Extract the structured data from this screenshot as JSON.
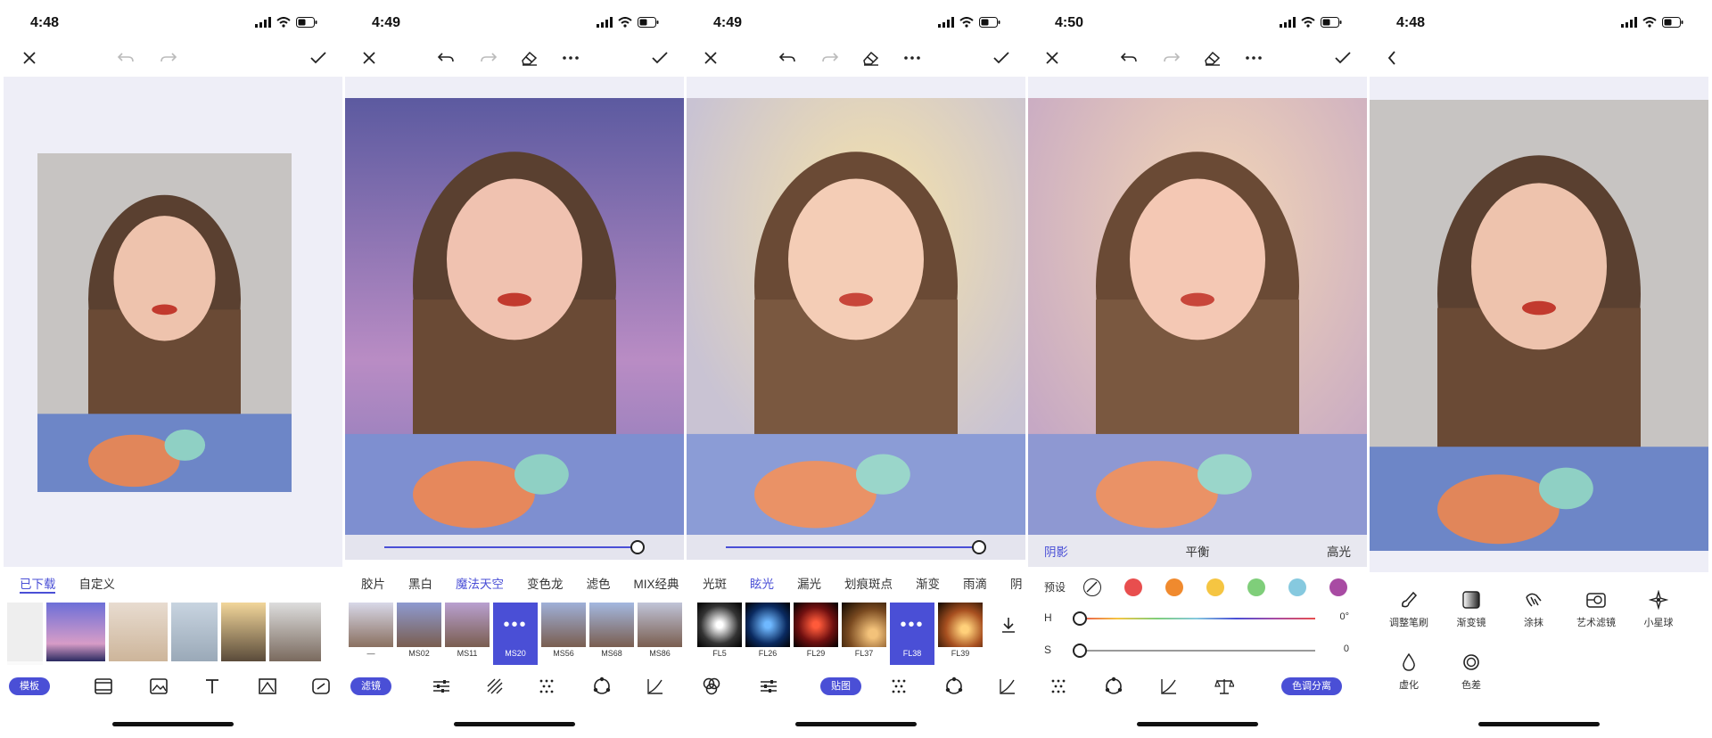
{
  "colors": {
    "accent": "#4a4fd6",
    "bg": "#eeeef7"
  },
  "screens": [
    {
      "time": "4:48",
      "tabs": [
        "已下载",
        "自定义"
      ],
      "bottom_pill": "模板"
    },
    {
      "time": "4:49",
      "tabs": [
        "胶片",
        "黑白",
        "魔法天空",
        "变色龙",
        "滤色",
        "MIX经典"
      ],
      "thumbs": [
        "—",
        "MS02",
        "MS11",
        "MS20",
        "MS56",
        "MS68",
        "MS86"
      ],
      "bottom_pill": "滤镜"
    },
    {
      "time": "4:49",
      "tabs": [
        "光斑",
        "眩光",
        "漏光",
        "划痕斑点",
        "渐变",
        "雨滴",
        "阴"
      ],
      "thumbs": [
        "FL5",
        "FL26",
        "FL29",
        "FL37",
        "FL38",
        "FL39"
      ],
      "bottom_pill": "贴图"
    },
    {
      "time": "4:50",
      "tone_tabs": [
        "阴影",
        "平衡",
        "高光"
      ],
      "preset_label": "预设",
      "preset_colors": [
        "#e84e4e",
        "#f08a2e",
        "#f5c542",
        "#7fce7a",
        "#86c9df",
        "#a84ba3"
      ],
      "h_label": "H",
      "h_value": "0°",
      "s_label": "S",
      "s_value": "0",
      "bottom_pill": "色调分离"
    },
    {
      "time": "4:48",
      "tools": [
        "调整笔刷",
        "渐变镜",
        "涂抹",
        "艺术滤镜",
        "小星球",
        "虚化",
        "色差"
      ]
    }
  ]
}
